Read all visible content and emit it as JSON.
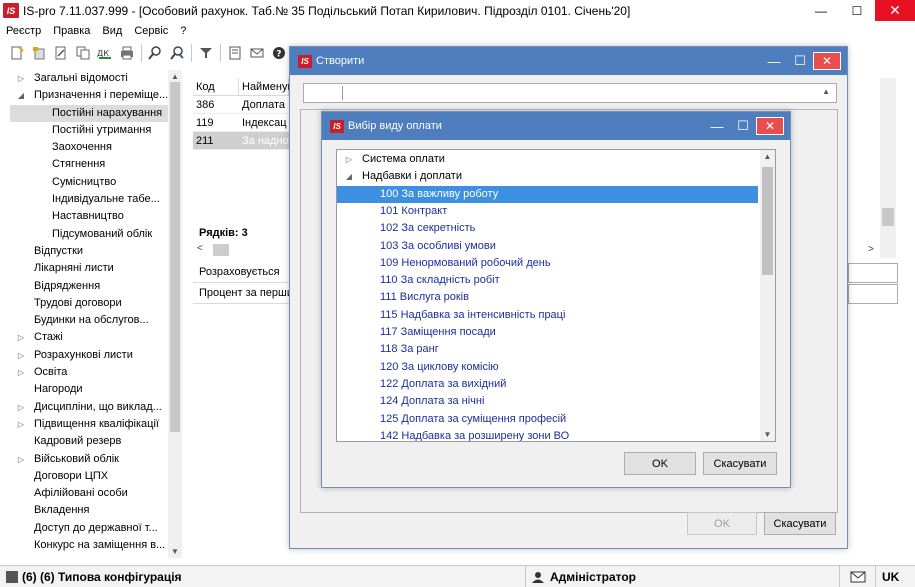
{
  "window": {
    "logo": "IS",
    "title": "IS-pro 7.11.037.999 - [Особовий рахунок. Таб.№ 35 Подільський Потап Кирилович. Підрозділ 0101. Січень'20]",
    "min": "—",
    "max": "☐",
    "close": "✕"
  },
  "menu": [
    "Реєстр",
    "Правка",
    "Вид",
    "Сервіс",
    "?"
  ],
  "toolbar_icons": [
    "new-doc-icon",
    "new-group-icon",
    "edit-icon",
    "copy-icon",
    "dk-icon",
    "print-icon",
    "find-icon",
    "find-next-icon",
    "filter-icon",
    "form-icon",
    "mail-icon",
    "help-icon"
  ],
  "tree": [
    {
      "label": "Загальні відомості",
      "level": 0,
      "arrow": "▷"
    },
    {
      "label": "Призначення і переміще...",
      "level": 0,
      "arrow": "◢"
    },
    {
      "label": "Постійні нарахування",
      "level": 1,
      "arrow": "",
      "selected": true
    },
    {
      "label": "Постійні утримання",
      "level": 1,
      "arrow": ""
    },
    {
      "label": "Заохочення",
      "level": 1,
      "arrow": ""
    },
    {
      "label": "Стягнення",
      "level": 1,
      "arrow": ""
    },
    {
      "label": "Сумісництво",
      "level": 1,
      "arrow": ""
    },
    {
      "label": "Індивідуальне табе...",
      "level": 1,
      "arrow": ""
    },
    {
      "label": "Наставництво",
      "level": 1,
      "arrow": ""
    },
    {
      "label": "Підсумований облік",
      "level": 1,
      "arrow": ""
    },
    {
      "label": "Відпустки",
      "level": 0,
      "arrow": ""
    },
    {
      "label": "Лікарняні листи",
      "level": 0,
      "arrow": ""
    },
    {
      "label": "Відрядження",
      "level": 0,
      "arrow": ""
    },
    {
      "label": "Трудові договори",
      "level": 0,
      "arrow": ""
    },
    {
      "label": "Будинки на обслугов...",
      "level": 0,
      "arrow": ""
    },
    {
      "label": "Стажі",
      "level": 0,
      "arrow": "▷"
    },
    {
      "label": "Розрахункові листи",
      "level": 0,
      "arrow": "▷"
    },
    {
      "label": "Освіта",
      "level": 0,
      "arrow": "▷"
    },
    {
      "label": "Нагороди",
      "level": 0,
      "arrow": ""
    },
    {
      "label": "Дисципліни, що виклад...",
      "level": 0,
      "arrow": "▷"
    },
    {
      "label": "Підвищення кваліфікації",
      "level": 0,
      "arrow": "▷"
    },
    {
      "label": "Кадровий резерв",
      "level": 0,
      "arrow": ""
    },
    {
      "label": "Військовий облік",
      "level": 0,
      "arrow": "▷"
    },
    {
      "label": "Договори ЦПХ",
      "level": 0,
      "arrow": ""
    },
    {
      "label": "Афілійовані особи",
      "level": 0,
      "arrow": ""
    },
    {
      "label": "Вкладення",
      "level": 0,
      "arrow": ""
    },
    {
      "label": "Доступ до державної т...",
      "level": 0,
      "arrow": ""
    },
    {
      "label": "Конкурс на заміщення в...",
      "level": 0,
      "arrow": ""
    }
  ],
  "grid": {
    "headers": [
      "Код",
      "Найменув"
    ],
    "rows": [
      {
        "code": "386",
        "name": "Доплата"
      },
      {
        "code": "119",
        "name": "Індексац"
      },
      {
        "code": "211",
        "name": "За надно",
        "selected": true
      }
    ],
    "rows_count": "Рядків: 3"
  },
  "lower_panel": [
    "Розраховується",
    "Процент за перши"
  ],
  "status": {
    "config": "(6) (6) Типова конфігурація",
    "user": "Адміністратор",
    "lang": "UK"
  },
  "dialog_create": {
    "title": "Створити",
    "ok": "OK",
    "cancel": "Скасувати"
  },
  "dialog_pick": {
    "title": "Вибір виду оплати",
    "ok": "OK",
    "cancel": "Скасувати",
    "groups": [
      {
        "label": "Система оплати",
        "arrow": "▷"
      },
      {
        "label": "Надбавки і доплати",
        "arrow": "◢"
      }
    ],
    "items": [
      {
        "label": "100 За важливу роботу",
        "selected": true
      },
      {
        "label": "101 Контракт"
      },
      {
        "label": "102 За секретність"
      },
      {
        "label": "103 За особливі умови"
      },
      {
        "label": "109 Ненормований робочий день"
      },
      {
        "label": "110 За складність робіт"
      },
      {
        "label": "111 Вислуга років"
      },
      {
        "label": "115 Надбавка за інтенсивність праці"
      },
      {
        "label": "117 Заміщення посади"
      },
      {
        "label": "118 За ранг"
      },
      {
        "label": "120 За циклову комісію"
      },
      {
        "label": "122 Доплата за вихідний"
      },
      {
        "label": "124 Доплата за нічні"
      },
      {
        "label": "125 Доплата за суміщення професій"
      },
      {
        "label": "142 Надбавка за розширену зони ВО"
      }
    ]
  },
  "colors": {
    "dialog_title": "#4f7ebf",
    "selection": "#3d8fe0",
    "item_text": "#1c2f9c",
    "close_red": "#e81123"
  }
}
